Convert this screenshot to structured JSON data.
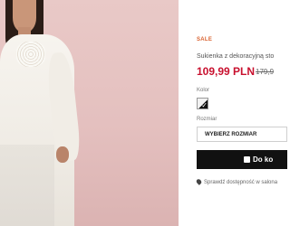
{
  "product": {
    "badge": "SALE",
    "title": "Sukienka z dekoracyjną sto",
    "price": "109,99 PLN",
    "old_price": "179,9"
  },
  "color": {
    "label": "Kolor",
    "selected_swatch": "white-black"
  },
  "size": {
    "label": "Rozmiar",
    "select_placeholder": "WYBIERZ ROZMIAR"
  },
  "cart": {
    "add_label": "Do ko"
  },
  "store": {
    "check_label": "Sprawdź dostępność w salona"
  },
  "icons": {
    "bag": "shopping-bag-icon",
    "pin": "location-pin-icon",
    "check": "checkmark-icon"
  },
  "colors": {
    "sale": "#d9612e",
    "price": "#c8102e",
    "button": "#111111"
  }
}
